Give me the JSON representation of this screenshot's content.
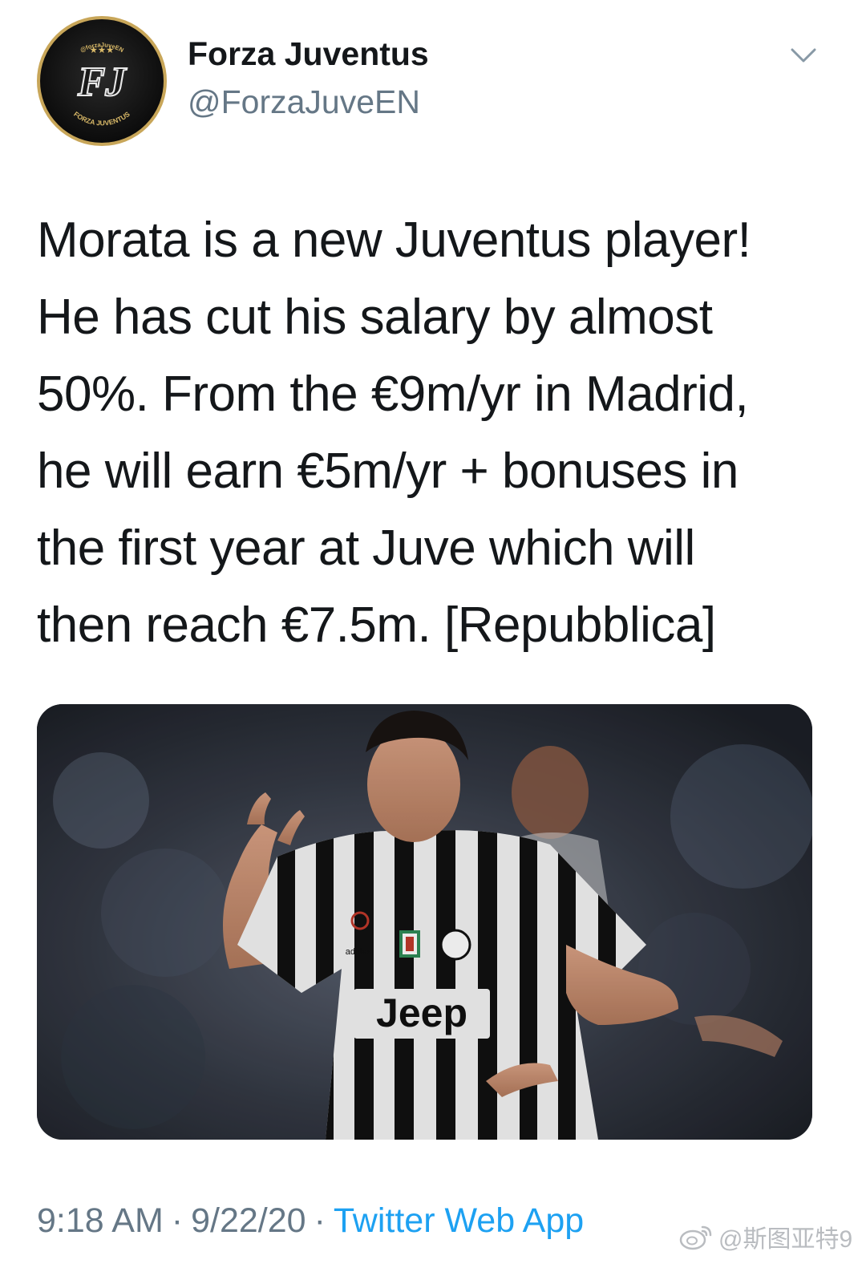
{
  "tweet": {
    "author": {
      "display_name": "Forza Juventus",
      "handle": "@ForzaJuveEN",
      "avatar": {
        "monogram": "FJ",
        "top_text": "@forzaJuveEN",
        "bottom_text": "FORZA JUVENTUS",
        "stars": "★★★",
        "ring_color": "#c8a659"
      }
    },
    "menu_icon": "chevron-down-icon",
    "text_lines": [
      "Morata is a new Juventus player!",
      "He has cut his salary by almost",
      "50%. From the €9m/yr in Madrid,",
      "he will earn €5m/yr + bonuses in",
      "the first year at Juve which will",
      "then reach €7.5m. [Repubblica]"
    ],
    "media": {
      "jersey_sponsor": "Jeep",
      "jersey_brand": "adidas"
    },
    "time": "9:18 AM",
    "date": "9/22/20",
    "separator": "·",
    "source_app": "Twitter Web App"
  },
  "watermark": {
    "text": "@斯图亚特9",
    "icon": "weibo-icon"
  },
  "colors": {
    "text_primary": "#14171a",
    "text_secondary": "#657786",
    "link": "#1da1f2"
  }
}
